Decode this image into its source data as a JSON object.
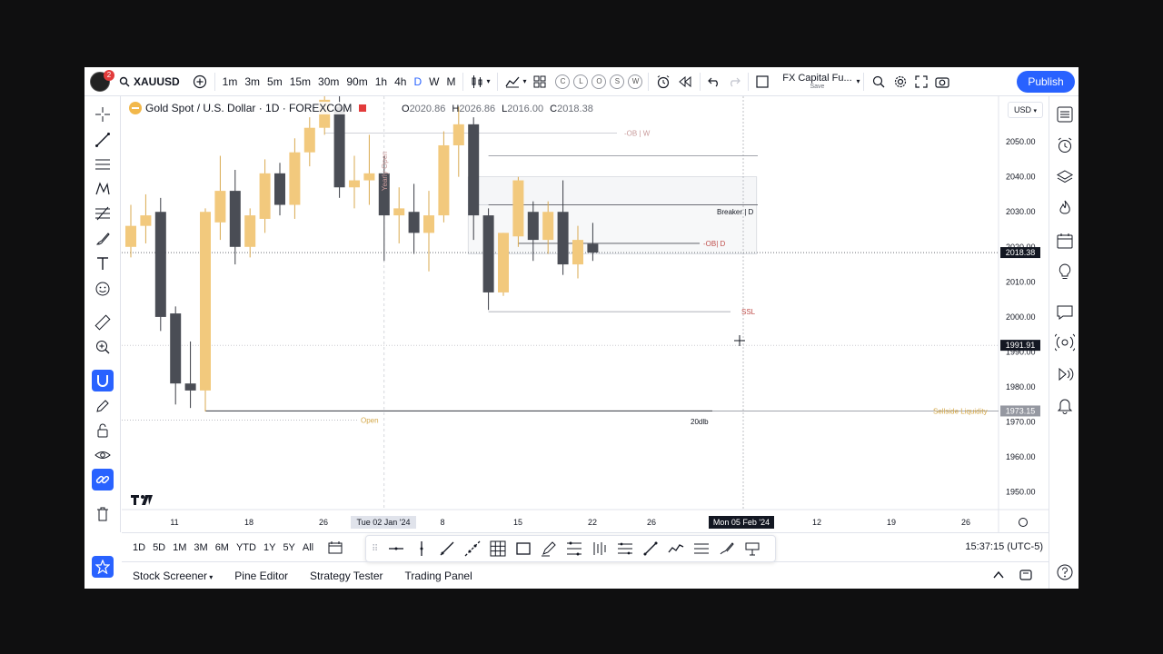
{
  "header": {
    "symbol": "XAUUSD",
    "intervals": [
      "1m",
      "3m",
      "5m",
      "15m",
      "30m",
      "90m",
      "1h",
      "4h",
      "D",
      "W",
      "M"
    ],
    "active_interval": "D",
    "indicator_circles": [
      "C",
      "L",
      "O",
      "S",
      "W"
    ],
    "layout_name": "FX Capital Fu...",
    "layout_status": "Save",
    "publish_label": "Publish",
    "notification_count": "2"
  },
  "legend": {
    "title": "Gold Spot / U.S. Dollar · 1D · FOREXCOM",
    "o_label": "O",
    "o_value": "2020.86",
    "h_label": "H",
    "h_value": "2026.86",
    "l_label": "L",
    "l_value": "2016.00",
    "c_label": "C",
    "c_value": "2018.38"
  },
  "currency": "USD",
  "chart_data": {
    "type": "candlestick",
    "price_axis": {
      "ticks": [
        "2050.00",
        "2040.00",
        "2030.00",
        "2020.00",
        "2010.00",
        "2000.00",
        "1990.00",
        "1980.00",
        "1970.00",
        "1960.00",
        "1950.00"
      ],
      "range": [
        1945,
        2063
      ]
    },
    "time_axis": {
      "ticks": [
        "11",
        "18",
        "26",
        "Tue 02 Jan '24",
        "8",
        "15",
        "22",
        "26",
        "Mon 05 Feb '24",
        "12",
        "19",
        "26"
      ]
    },
    "price_labels": [
      {
        "price": 2018.38,
        "text": "2018.38",
        "color": "#131722"
      },
      {
        "price": 1991.91,
        "text": "1991.91",
        "color": "#131722"
      },
      {
        "price": 1973.15,
        "text": "1973.15",
        "color": "#9598a1"
      }
    ],
    "candles": [
      {
        "o": 2020,
        "h": 2032,
        "l": 2017,
        "c": 2026,
        "dir": "up"
      },
      {
        "o": 2026,
        "h": 2035,
        "l": 2021,
        "c": 2029,
        "dir": "up"
      },
      {
        "o": 2030,
        "h": 2034,
        "l": 1996,
        "c": 2000,
        "dir": "down"
      },
      {
        "o": 2001,
        "h": 2003,
        "l": 1975,
        "c": 1981,
        "dir": "down"
      },
      {
        "o": 1981,
        "h": 1993,
        "l": 1974,
        "c": 1979,
        "dir": "down"
      },
      {
        "o": 1979,
        "h": 2031,
        "l": 1973,
        "c": 2030,
        "dir": "up"
      },
      {
        "o": 2027,
        "h": 2046,
        "l": 2022,
        "c": 2036,
        "dir": "up"
      },
      {
        "o": 2036,
        "h": 2042,
        "l": 2015,
        "c": 2020,
        "dir": "down"
      },
      {
        "o": 2020,
        "h": 2031,
        "l": 2017,
        "c": 2029,
        "dir": "up"
      },
      {
        "o": 2028,
        "h": 2045,
        "l": 2024,
        "c": 2041,
        "dir": "up"
      },
      {
        "o": 2041,
        "h": 2044,
        "l": 2029,
        "c": 2032,
        "dir": "down"
      },
      {
        "o": 2032,
        "h": 2051,
        "l": 2028,
        "c": 2047,
        "dir": "up"
      },
      {
        "o": 2047,
        "h": 2057,
        "l": 2043,
        "c": 2054,
        "dir": "up"
      },
      {
        "o": 2054,
        "h": 2063,
        "l": 2052,
        "c": 2062,
        "dir": "up"
      },
      {
        "o": 2060,
        "h": 2064,
        "l": 2034,
        "c": 2037,
        "dir": "down"
      },
      {
        "o": 2037,
        "h": 2046,
        "l": 2031,
        "c": 2039,
        "dir": "up"
      },
      {
        "o": 2039,
        "h": 2052,
        "l": 2032,
        "c": 2041,
        "dir": "up"
      },
      {
        "o": 2041,
        "h": 2046,
        "l": 2016,
        "c": 2029,
        "dir": "down"
      },
      {
        "o": 2029,
        "h": 2037,
        "l": 2021,
        "c": 2031,
        "dir": "up"
      },
      {
        "o": 2030,
        "h": 2038,
        "l": 2018,
        "c": 2024,
        "dir": "down"
      },
      {
        "o": 2024,
        "h": 2036,
        "l": 2013,
        "c": 2029,
        "dir": "up"
      },
      {
        "o": 2029,
        "h": 2053,
        "l": 2027,
        "c": 2049,
        "dir": "up"
      },
      {
        "o": 2049,
        "h": 2060,
        "l": 2040,
        "c": 2055,
        "dir": "up"
      },
      {
        "o": 2055,
        "h": 2057,
        "l": 2022,
        "c": 2029,
        "dir": "down"
      },
      {
        "o": 2029,
        "h": 2031,
        "l": 2002,
        "c": 2007,
        "dir": "down"
      },
      {
        "o": 2007,
        "h": 2024,
        "l": 2006,
        "c": 2024,
        "dir": "up"
      },
      {
        "o": 2023,
        "h": 2040,
        "l": 2020,
        "c": 2039,
        "dir": "up"
      },
      {
        "o": 2030,
        "h": 2033,
        "l": 2016,
        "c": 2022,
        "dir": "down"
      },
      {
        "o": 2022,
        "h": 2033,
        "l": 2018,
        "c": 2030,
        "dir": "up"
      },
      {
        "o": 2030,
        "h": 2039,
        "l": 2012,
        "c": 2015,
        "dir": "down"
      },
      {
        "o": 2015,
        "h": 2026,
        "l": 2011,
        "c": 2022,
        "dir": "up"
      },
      {
        "o": 2020.86,
        "h": 2026.86,
        "l": 2016.0,
        "c": 2018.38,
        "dir": "down"
      }
    ],
    "annotations": [
      {
        "text": "-OB | W",
        "price": 2052.5,
        "color": "#c89a9a"
      },
      {
        "text": "Breaker | D",
        "price": 2030,
        "color": "#131722"
      },
      {
        "text": "-OB| D",
        "price": 2021,
        "color": "#c0504d"
      },
      {
        "text": "SSL",
        "price": 2001.5,
        "color": "#c0504d"
      },
      {
        "text": "20dlb",
        "price": 1971.5,
        "color": "#131722"
      },
      {
        "text": "Sellside Liquidity",
        "price": 1973.15,
        "color": "#d4a84a"
      },
      {
        "text": "Open",
        "price": 1970.5,
        "color": "#d4a84a"
      },
      {
        "text": "Yearly Open",
        "price": 2040,
        "color": "#c89a9a"
      }
    ],
    "colors": {
      "up": "#f2c97d",
      "down": "#4a4d55",
      "accent": "#2962ff"
    }
  },
  "range_bar": {
    "ranges": [
      "1D",
      "5D",
      "1M",
      "3M",
      "6M",
      "YTD",
      "1Y",
      "5Y",
      "All"
    ],
    "clock": "15:37:15 (UTC-5)"
  },
  "bottom_panel": {
    "tabs": [
      "Stock Screener",
      "Pine Editor",
      "Strategy Tester",
      "Trading Panel"
    ]
  }
}
